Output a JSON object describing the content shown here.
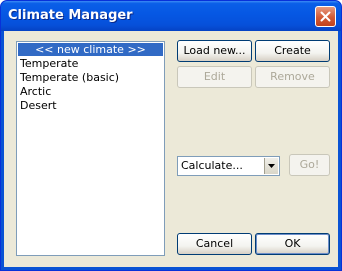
{
  "window": {
    "title": "Climate Manager",
    "close_icon": "close-icon"
  },
  "climates": {
    "items": [
      {
        "label": "<< new climate >>",
        "selected": true
      },
      {
        "label": "Temperate",
        "selected": false
      },
      {
        "label": "Temperate (basic)",
        "selected": false
      },
      {
        "label": "Arctic",
        "selected": false
      },
      {
        "label": "Desert",
        "selected": false
      }
    ]
  },
  "buttons": {
    "load_new": "Load new...",
    "create": "Create",
    "edit": "Edit",
    "remove": "Remove",
    "go": "Go!",
    "cancel": "Cancel",
    "ok": "OK"
  },
  "calculate": {
    "selected": "Calculate...",
    "arrow_icon": "chevron-down-icon"
  },
  "colors": {
    "title_bar": "#0a5fe8",
    "selection": "#316ac5",
    "dialog_bg": "#ece9d8",
    "close_button": "#d25a36"
  }
}
